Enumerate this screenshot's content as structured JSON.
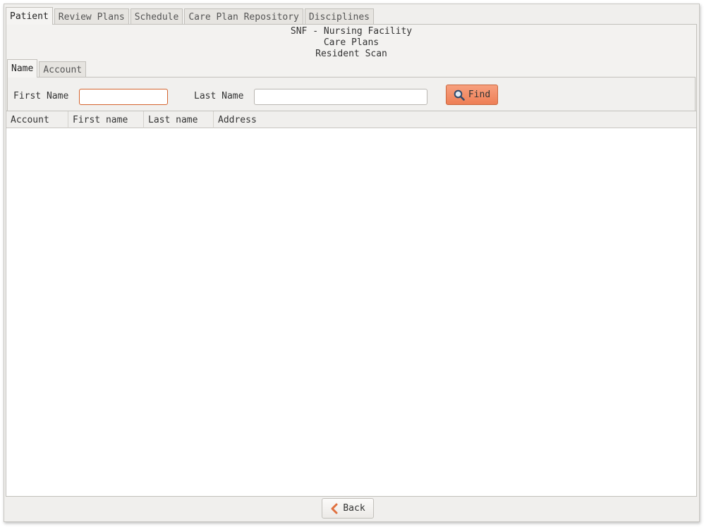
{
  "top_tabs": [
    {
      "label": "Patient",
      "active": true
    },
    {
      "label": "Review Plans",
      "active": false
    },
    {
      "label": "Schedule",
      "active": false
    },
    {
      "label": "Care Plan Repository",
      "active": false
    },
    {
      "label": "Disciplines",
      "active": false
    }
  ],
  "header": {
    "line1": "SNF - Nursing Facility",
    "line2": "Care Plans",
    "line3": "Resident Scan"
  },
  "sub_tabs": [
    {
      "label": "Name",
      "active": true
    },
    {
      "label": "Account",
      "active": false
    }
  ],
  "search": {
    "first_name_label": "First Name",
    "first_name_value": "",
    "last_name_label": "Last Name",
    "last_name_value": "",
    "find_label": "Find"
  },
  "table": {
    "columns": [
      "Account",
      "First name",
      "Last name",
      "Address"
    ],
    "rows": []
  },
  "footer": {
    "back_label": "Back"
  },
  "colors": {
    "accent": "#ee7f56",
    "focus_border": "#d4632e"
  },
  "icons": {
    "find": "magnifier-icon",
    "back": "chevron-left-icon"
  }
}
